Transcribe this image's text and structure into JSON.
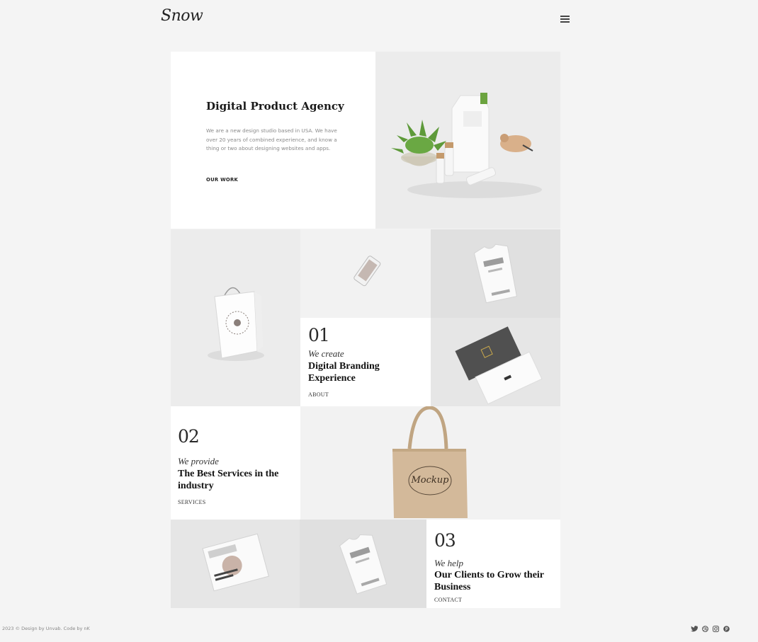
{
  "brand": {
    "logo_text": "Snow"
  },
  "nav": {
    "menu_icon": "hamburger-menu-icon"
  },
  "hero": {
    "title": "Digital Product Agency",
    "text": "We are a new design studio based in USA. We have over 20 years of combined experience, and know a thing or two about designing websites and apps.",
    "link_label": "OUR WORK"
  },
  "features": [
    {
      "number": "01",
      "lead": "We create",
      "heading": "Digital Branding Experience",
      "link_label": "ABOUT"
    },
    {
      "number": "02",
      "lead": "We provide",
      "heading": "The Best Services in the industry",
      "link_label": "SERVICES"
    },
    {
      "number": "03",
      "lead": "We help",
      "heading": "Our Clients to Grow their Business",
      "link_label": "CONTACT"
    }
  ],
  "images": {
    "hero_image": "packaging-mockup-image",
    "shopping_bag": "shopping-bag-mockup-image",
    "phone": "phone-mockup-image",
    "tshirt": "tshirt-mockup-image",
    "cards": "business-cards-mockup-image",
    "tote": "tote-bag-mockup-image",
    "tote_text": "Mockup",
    "magazine": "magazine-mockup-image",
    "tshirt2": "tshirt-mockup-image-2"
  },
  "footer": {
    "copyright": "2023 © Design by Unvab. Code by nK",
    "social_icons": [
      "twitter-icon",
      "dribbble-icon",
      "instagram-icon",
      "pinterest-icon"
    ]
  }
}
